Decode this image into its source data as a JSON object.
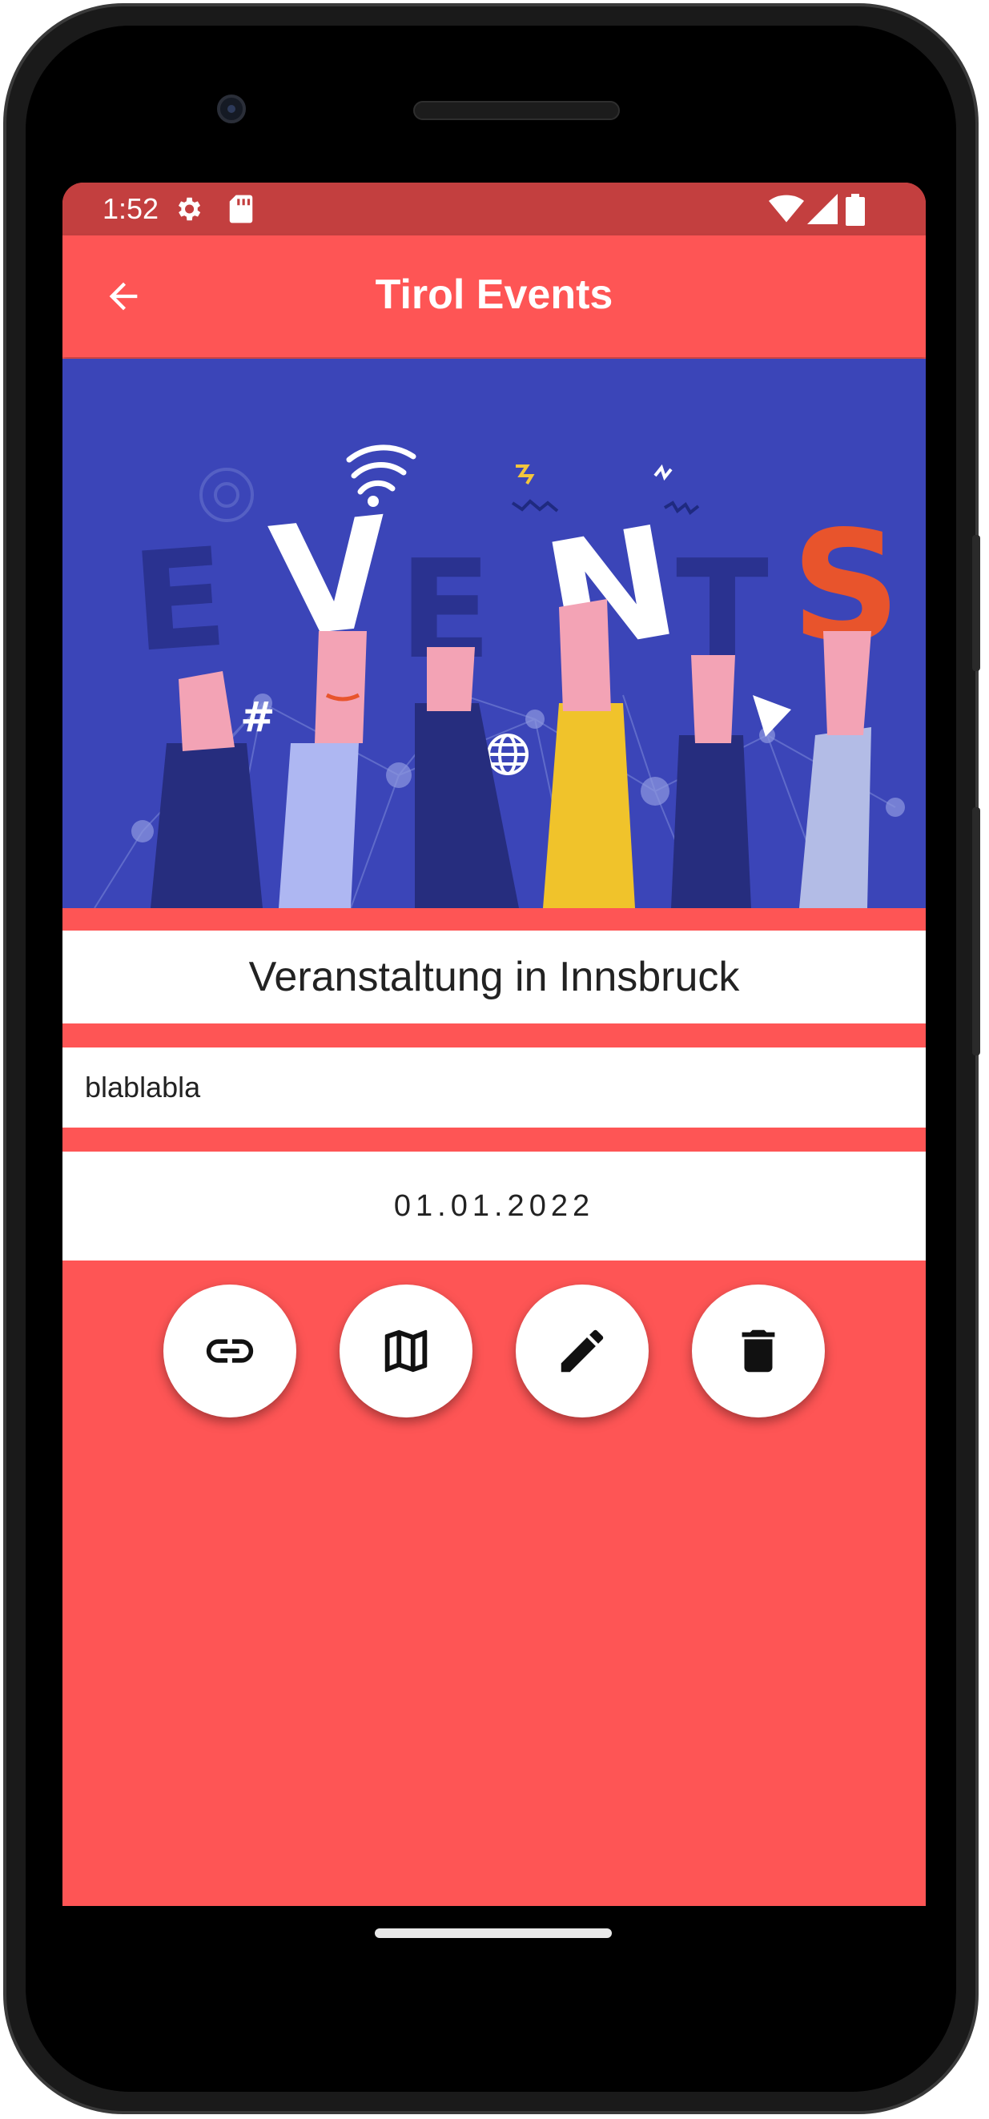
{
  "status_bar": {
    "time": "1:52",
    "icons": [
      "settings-icon",
      "sd-card-icon",
      "wifi-icon",
      "signal-icon",
      "battery-icon"
    ]
  },
  "app_bar": {
    "title": "Tirol Events",
    "back_icon": "arrow-back-icon"
  },
  "banner": {
    "text": "EVENTS"
  },
  "event": {
    "title": "Veranstaltung in Innsbruck",
    "description": "blablabla",
    "date": "01.01.2022"
  },
  "actions": [
    {
      "icon": "link-icon"
    },
    {
      "icon": "map-icon"
    },
    {
      "icon": "edit-icon"
    },
    {
      "icon": "delete-icon"
    }
  ],
  "colors": {
    "primary": "#fe5555",
    "status_bar": "#c33f3f",
    "banner_bg": "#3b45b8"
  }
}
